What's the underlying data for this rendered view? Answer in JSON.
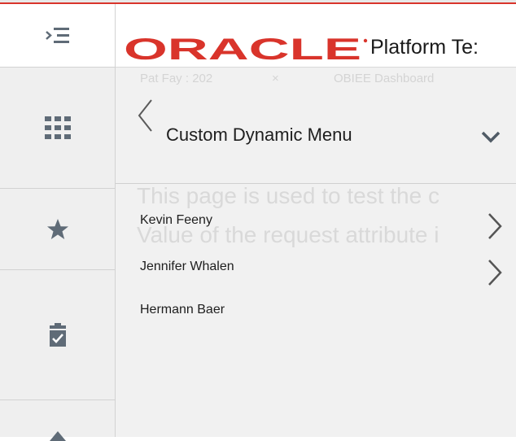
{
  "brand": {
    "logo_text": "ORACLE",
    "app_title": "Platform Te:"
  },
  "rail": {
    "icons": [
      "menu-toggle-icon",
      "app-grid-icon",
      "star-icon",
      "clipboard-check-icon",
      "up-arrow-icon"
    ]
  },
  "background": {
    "breadcrumb": [
      "Pat Fay : 202",
      "×",
      "OBIEE Dashboard"
    ],
    "lines": [
      "This page is used to test the c",
      "Value of the request attribute i"
    ]
  },
  "panel": {
    "title": "Custom Dynamic Menu",
    "items": [
      {
        "label": "Kevin Feeny",
        "has_submenu": true
      },
      {
        "label": "Jennifer Whalen",
        "has_submenu": true
      },
      {
        "label": "Hermann Baer",
        "has_submenu": false
      }
    ]
  },
  "colors": {
    "brand_red": "#d9342b",
    "rail_bg": "#efefef",
    "icon_gray": "#5f6b77"
  }
}
